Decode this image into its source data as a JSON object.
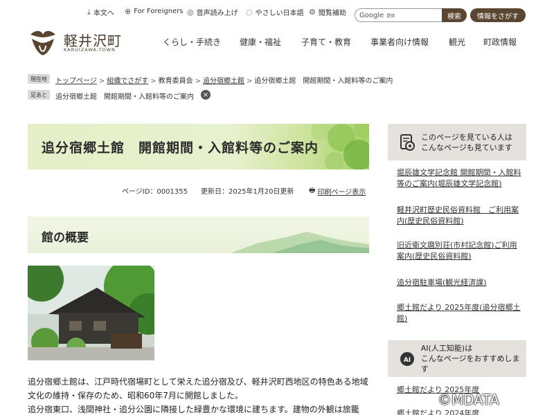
{
  "utility": {
    "text_only": "本文へ",
    "foreigners": "For Foreigners",
    "read_aloud": "音声読み上げ",
    "easy_japanese": "やさしい日本語",
    "accessibility": "閲覧補助",
    "search_brand": "Google",
    "search_brand_sub": "提供",
    "search_button": "検索",
    "info_button": "情報をさがす"
  },
  "header": {
    "site_name": "軽井沢町",
    "site_name_en": "KARUIZAWA-TOWN",
    "nav": [
      "くらし・手続き",
      "健康・福祉",
      "子育て・教育",
      "事業者向け情報",
      "観光",
      "町政情報"
    ]
  },
  "breadcrumb": {
    "location_tag": "現在地",
    "items": [
      "トップページ",
      "組織でさがす",
      "教育委員会",
      "追分宿郷土館"
    ],
    "current": "追分宿郷土館　開館期間・入館料等のご案内",
    "history_tag": "足あと",
    "history_item": "追分宿郷土館　開館期間・入館料等のご案内",
    "clear_icon": "×"
  },
  "main": {
    "title": "追分宿郷土館　開館期間・入館料等のご案内",
    "page_id": "ページID：0001355",
    "updated": "更新日：2025年1月20日更新",
    "print": "印刷ページ表示",
    "section_title": "館の概要",
    "paragraph_1": "追分宿郷土館は、江戸時代宿場町として栄えた追分宿及び、軽井沢町西地区の特色ある地域文化の維持・保存のため、昭和60年7月に開館しました。",
    "paragraph_2": "追分宿東口、浅間神社・追分公園に隣接した緑豊かな環境に建ちます。建物の外観は旅籠"
  },
  "sidebar": {
    "related_head": [
      "このページを見ている人は",
      "こんなページも見ています"
    ],
    "related_links": [
      "堀辰雄文学記念館 開館期間・入館料等のご案内(堀辰雄文学記念館)",
      "軽井沢町歴史民俗資料館　ご利用案内(歴史民俗資料館)",
      "旧近衛文麿別荘(市村記念館)ご利用案内(歴史民俗資料館)",
      "追分宿駐車場(観光経済課)",
      "郷土館だより 2025年度(追分宿郷土館)"
    ],
    "ai_head": [
      "AI(人工知能)は",
      "こんなページをおすすめします"
    ],
    "ai_links": [
      "郷土館だより 2025年度",
      "郷土館だより 2024年度"
    ]
  },
  "watermark": "©MDATA",
  "colors": {
    "brand_brown": "#5a4530",
    "title_green": "#e4efc8",
    "side_gray": "#e5e1dd"
  }
}
